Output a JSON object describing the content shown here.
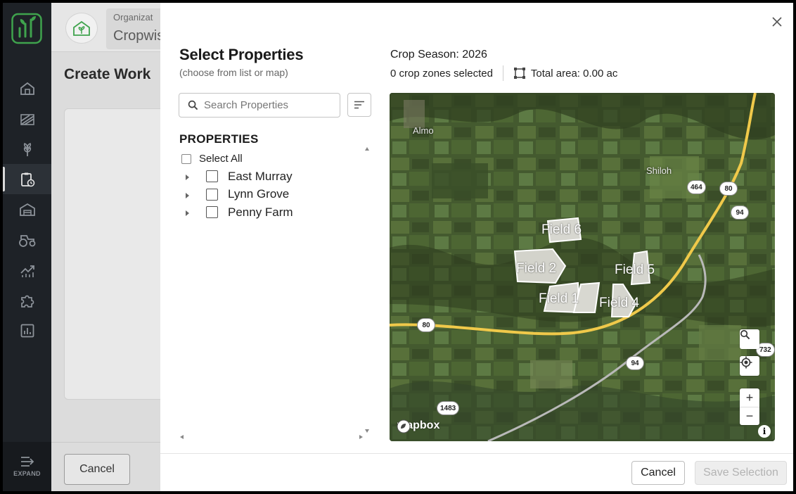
{
  "app": {
    "org_label": "Organizat",
    "org_name": "Cropwis",
    "page_title": "Create Work",
    "cancel_label": "Cancel",
    "expand_label": "EXPAND",
    "nav_icons": [
      "home-icon",
      "field-icon",
      "crop-icon",
      "worklog-icon",
      "warehouse-icon",
      "tractor-icon",
      "growth-icon",
      "puzzle-icon",
      "report-icon"
    ],
    "active_nav": 3
  },
  "modal": {
    "title": "Select Properties",
    "subtitle": "(choose from list or map)",
    "search_placeholder": "Search Properties",
    "properties_heading": "PROPERTIES",
    "select_all_label": "Select All",
    "properties": [
      {
        "name": "East Murray"
      },
      {
        "name": "Lynn Grove"
      },
      {
        "name": "Penny Farm"
      }
    ],
    "crop_season": "Crop Season: 2026",
    "zones_selected": "0 crop zones selected",
    "total_area": "Total area: 0.00 ac",
    "cancel_label": "Cancel",
    "save_label": "Save Selection"
  },
  "map": {
    "towns": [
      "Almo",
      "Shiloh"
    ],
    "road_shields": [
      "464",
      "80",
      "94",
      "80",
      "94",
      "732",
      "1483"
    ],
    "fields": [
      "Field 6",
      "Field 2",
      "Field 5",
      "Field 1",
      "Field 4"
    ],
    "attribution": "mapbox",
    "info_glyph": "i",
    "zoom_in": "+",
    "zoom_out": "−"
  },
  "colors": {
    "sidebar_bg": "#1e2227",
    "brand_green": "#3fa34d",
    "highway": "#f0c94a",
    "road": "#b9b9b9"
  }
}
